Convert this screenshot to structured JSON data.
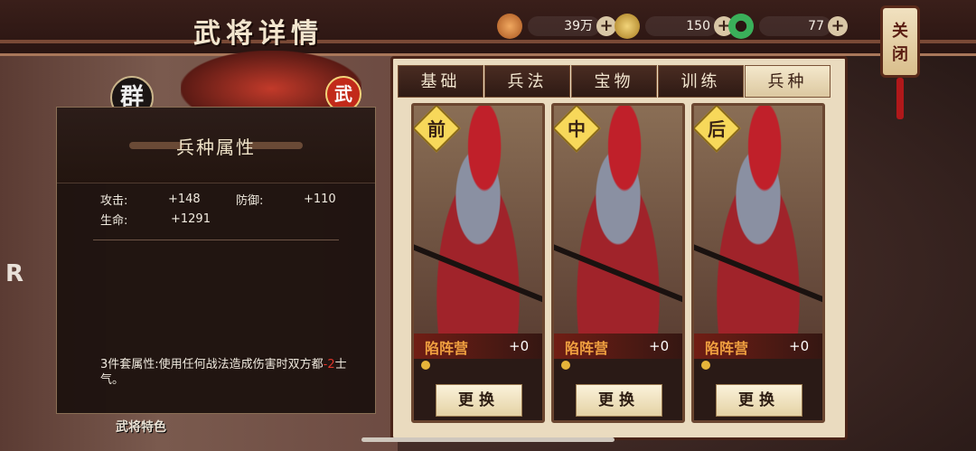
{
  "header": {
    "title": "武将详情",
    "resources": [
      {
        "icon": "copper-coin-icon",
        "value": "39万",
        "color": "#d8873a"
      },
      {
        "icon": "grain-icon",
        "value": "150",
        "color": "#c9a34a"
      },
      {
        "icon": "jade-icon",
        "value": "77",
        "color": "#3ab05a"
      }
    ],
    "close_label": [
      "关",
      "闭"
    ]
  },
  "hero": {
    "faction_badge": "群",
    "type_badge": "武",
    "caption": "武将特色"
  },
  "info_panel": {
    "title": "兵种属性",
    "stats": [
      {
        "label": "攻击:",
        "value": "+148"
      },
      {
        "label": "防御:",
        "value": "+110"
      },
      {
        "label": "生命:",
        "value": "+1291"
      }
    ],
    "set_desc_prefix": "3件套属性:使用任何战法造成伤害时双方都",
    "set_desc_highlight": "-2",
    "set_desc_suffix": "士气。"
  },
  "tabs": [
    {
      "label": "基础",
      "active": false
    },
    {
      "label": "兵法",
      "active": false
    },
    {
      "label": "宝物",
      "active": false
    },
    {
      "label": "训练",
      "active": false
    },
    {
      "label": "兵种",
      "active": true
    }
  ],
  "cards": [
    {
      "position": "前",
      "unit_name": "陷阵营",
      "bonus": "+0",
      "swap_label": "更换"
    },
    {
      "position": "中",
      "unit_name": "陷阵营",
      "bonus": "+0",
      "swap_label": "更换"
    },
    {
      "position": "后",
      "unit_name": "陷阵营",
      "bonus": "+0",
      "swap_label": "更换"
    }
  ],
  "colors": {
    "accent_gold": "#f7d85a",
    "unit_name": "#f0a040",
    "highlight_red": "#e0352a"
  }
}
